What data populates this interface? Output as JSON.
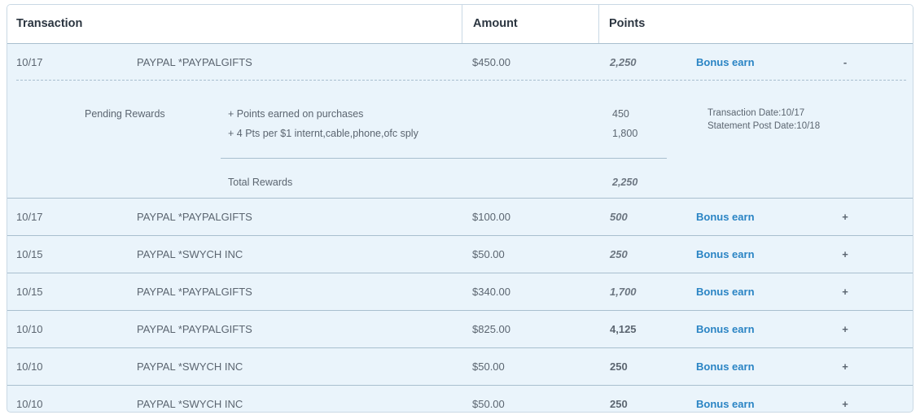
{
  "header": {
    "transaction": "Transaction",
    "amount": "Amount",
    "points": "Points"
  },
  "expanded": {
    "date": "10/17",
    "merchant": "PAYPAL *PAYPALGIFTS",
    "amount": "$450.00",
    "points": "2,250",
    "bonus": "Bonus earn",
    "toggle": "-",
    "details": {
      "label": "Pending Rewards",
      "line1": "+ Points earned on purchases",
      "line1_points": "450",
      "line2": "+ 4 Pts per $1 internt,cable,phone,ofc sply",
      "line2_points": "1,800",
      "transaction_date": "Transaction Date:10/17",
      "statement_post_date": "Statement Post Date:10/18",
      "total_label": "Total Rewards",
      "total_points": "2,250"
    }
  },
  "rows": [
    {
      "date": "10/17",
      "merchant": "PAYPAL *PAYPALGIFTS",
      "amount": "$100.00",
      "points": "500",
      "bonus": "Bonus earn",
      "toggle": "+",
      "pending": true
    },
    {
      "date": "10/15",
      "merchant": "PAYPAL *SWYCH INC",
      "amount": "$50.00",
      "points": "250",
      "bonus": "Bonus earn",
      "toggle": "+",
      "pending": true
    },
    {
      "date": "10/15",
      "merchant": "PAYPAL *PAYPALGIFTS",
      "amount": "$340.00",
      "points": "1,700",
      "bonus": "Bonus earn",
      "toggle": "+",
      "pending": true
    },
    {
      "date": "10/10",
      "merchant": "PAYPAL *PAYPALGIFTS",
      "amount": "$825.00",
      "points": "4,125",
      "bonus": "Bonus earn",
      "toggle": "+",
      "pending": false
    },
    {
      "date": "10/10",
      "merchant": "PAYPAL *SWYCH INC",
      "amount": "$50.00",
      "points": "250",
      "bonus": "Bonus earn",
      "toggle": "+",
      "pending": false
    },
    {
      "date": "10/10",
      "merchant": "PAYPAL *SWYCH INC",
      "amount": "$50.00",
      "points": "250",
      "bonus": "Bonus earn",
      "toggle": "+",
      "pending": false
    }
  ],
  "colors": {
    "accent": "#2a84c4",
    "row_background": "#eaf4fb",
    "border": "#a9bfcf"
  }
}
